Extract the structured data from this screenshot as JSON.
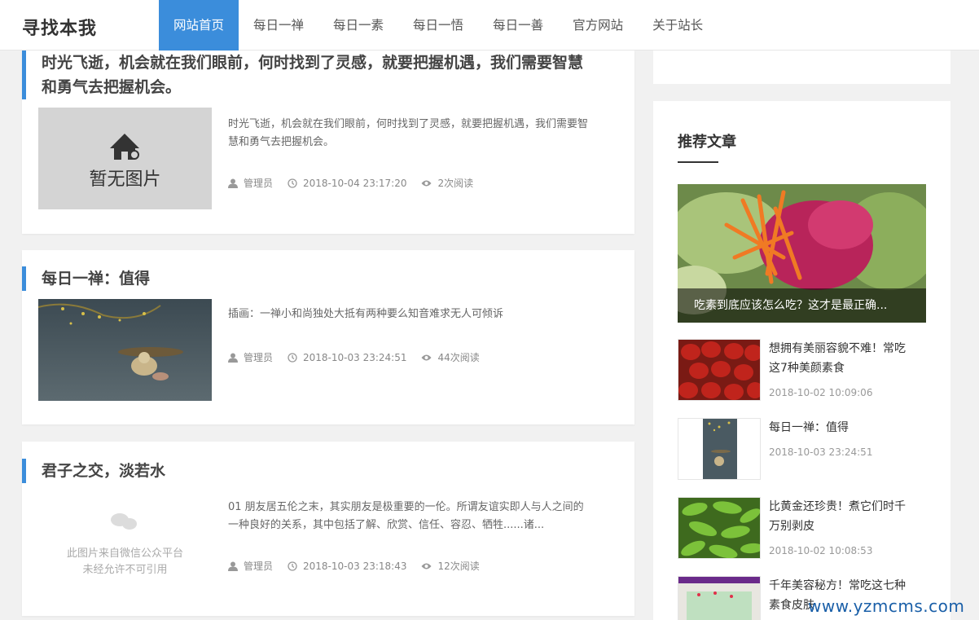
{
  "header": {
    "logo": "寻找本我",
    "nav": [
      {
        "label": "网站首页",
        "active": true
      },
      {
        "label": "每日一禅"
      },
      {
        "label": "每日一素"
      },
      {
        "label": "每日一悟"
      },
      {
        "label": "每日一善"
      },
      {
        "label": "官方网站"
      },
      {
        "label": "关于站长"
      }
    ]
  },
  "articles": [
    {
      "title_line1": "时光飞逝，机会就在我们眼前，何时找到了灵感，就要把握机遇，我们需要智慧",
      "title_line2": "和勇气去把握机会。",
      "thumb_text": "暂无图片",
      "excerpt_line1": "时光飞逝，机会就在我们眼前，何时找到了灵感，就要把握机遇，我们需要智",
      "excerpt_line2": "慧和勇气去把握机会。",
      "author": "管理员",
      "time": "2018-10-04 23:17:20",
      "views": "2次阅读"
    },
    {
      "title_line1": "每日一禅：值得",
      "excerpt_line1": "插画：一禅小和尚独处大抵有两种要么知音难求无人可倾诉",
      "author": "管理员",
      "time": "2018-10-03 23:24:51",
      "views": "44次阅读"
    },
    {
      "title_line1": "君子之交，淡若水",
      "thumb_text_line1": "此图片来自微信公众平台",
      "thumb_text_line2": "未经允许不可引用",
      "excerpt_line1": "01 朋友居五伦之末，其实朋友是极重要的一伦。所谓友谊实即人与人之间的",
      "excerpt_line2": "一种良好的关系，其中包括了解、欣赏、信任、容忍、牺牲......诸...",
      "author": "管理员",
      "time": "2018-10-03 23:18:43",
      "views": "12次阅读"
    }
  ],
  "sidebar": {
    "title": "推荐文章",
    "featured_caption": "吃素到底应该怎么吃？这才是最正确...",
    "items": [
      {
        "title_line1": "想拥有美丽容貌不难！常吃",
        "title_line2": "这7种美颜素食",
        "date": "2018-10-02 10:09:06"
      },
      {
        "title_line1": "每日一禅：值得",
        "title_line2": "",
        "date": "2018-10-03 23:24:51"
      },
      {
        "title_line1": "比黄金还珍贵！煮它们时千",
        "title_line2": "万别剥皮",
        "date": "2018-10-02 10:08:53"
      },
      {
        "title_line1": "千年美容秘方！常吃这七种",
        "title_line2": "素食皮肤",
        "date": ""
      }
    ]
  },
  "watermark": "www.yzmcms.com",
  "colors": {
    "accent": "#3b8ddb"
  }
}
